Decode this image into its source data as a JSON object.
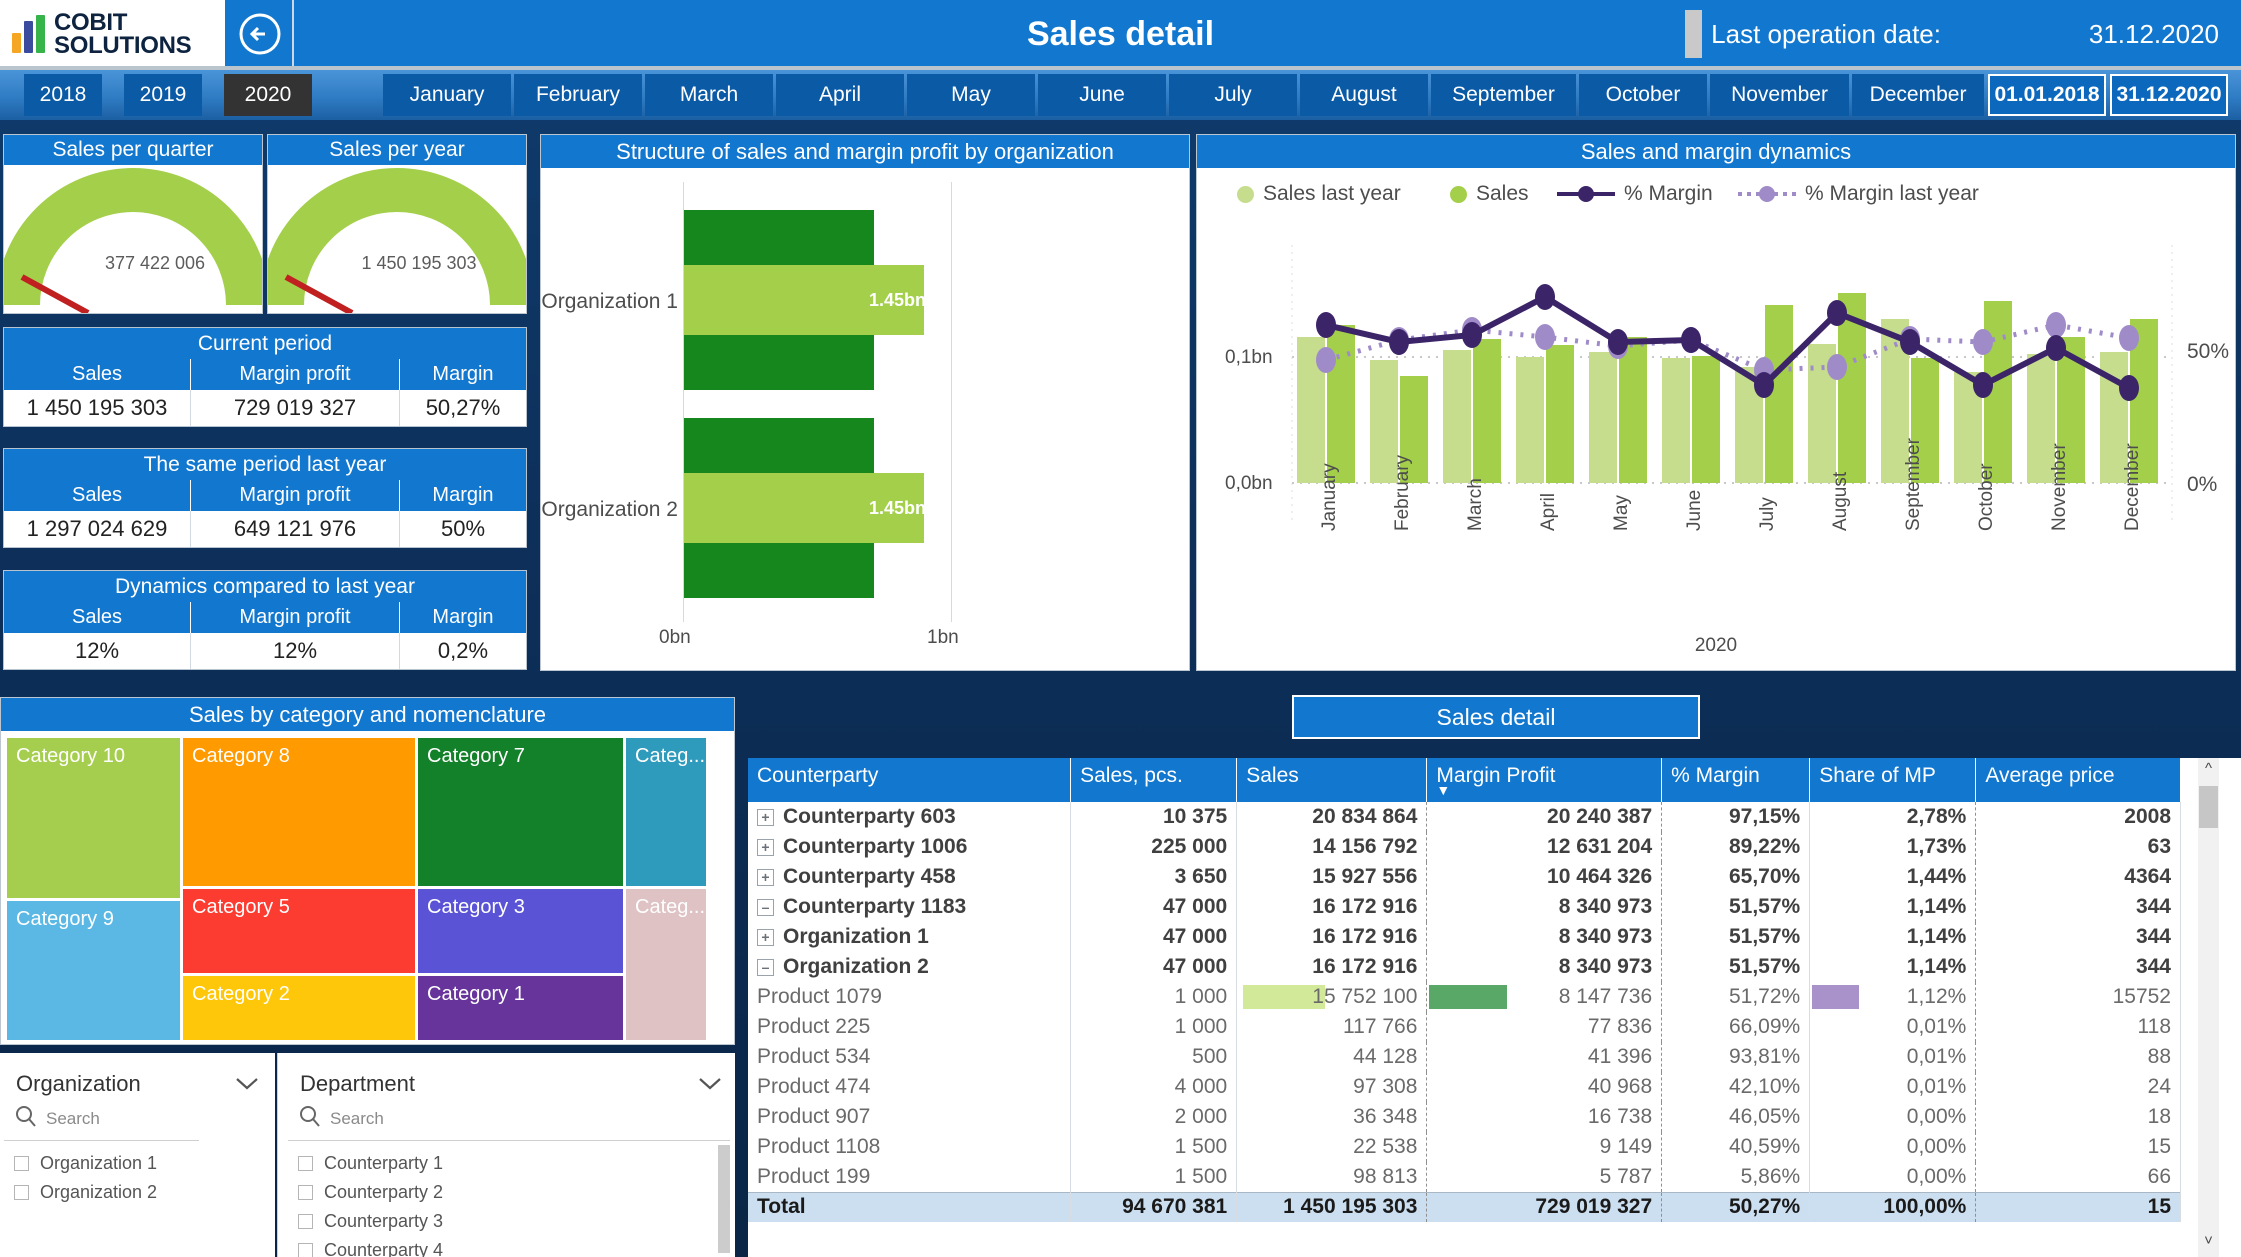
{
  "header": {
    "logo_line1": "COBIT",
    "logo_line2": "SOLUTIONS",
    "back_icon": "back-arrow-icon",
    "title": "Sales detail",
    "last_operation_label": "Last operation date:",
    "last_operation_date": "31.12.2020"
  },
  "filters": {
    "years": [
      {
        "label": "2018",
        "selected": false
      },
      {
        "label": "2019",
        "selected": false
      },
      {
        "label": "2020",
        "selected": true
      }
    ],
    "months": [
      "January",
      "February",
      "March",
      "April",
      "May",
      "June",
      "July",
      "August",
      "September",
      "October",
      "November",
      "December"
    ],
    "date_from": "01.01.2018",
    "date_to": "31.12.2020"
  },
  "gauges": [
    {
      "title": "Sales per quarter",
      "value": "377 422 006"
    },
    {
      "title": "Sales per year",
      "value": "1 450 195 303"
    }
  ],
  "kpi_tables": [
    {
      "title": "Current period",
      "columns": [
        "Sales",
        "Margin profit",
        "Margin"
      ],
      "values": [
        "1 450 195 303",
        "729 019 327",
        "50,27%"
      ]
    },
    {
      "title": "The same period last year",
      "columns": [
        "Sales",
        "Margin profit",
        "Margin"
      ],
      "values": [
        "1 297 024 629",
        "649 121 976",
        "50%"
      ]
    },
    {
      "title": "Dynamics compared to last year",
      "columns": [
        "Sales",
        "Margin profit",
        "Margin"
      ],
      "values": [
        "12%",
        "12%",
        "0,2%"
      ]
    }
  ],
  "org_chart": {
    "title": "Structure of sales and margin profit by organization",
    "chart_data": {
      "type": "bar",
      "title": "Structure of sales and margin profit by organization",
      "orientation": "horizontal",
      "categories": [
        "Organization 1",
        "Organization 2"
      ],
      "xlabel": "",
      "ylabel": "",
      "xlim": [
        0,
        1.45
      ],
      "xticks": [
        "0bn",
        "1bn"
      ],
      "grid": true,
      "series": [
        {
          "name": "Margin profit (top)",
          "color": "#16871d",
          "values": [
            0.73,
            0.73
          ],
          "labels": [
            "",
            ""
          ]
        },
        {
          "name": "Sales",
          "color": "#a4cf4b",
          "values": [
            1.45,
            1.45
          ],
          "labels": [
            "1.45bn",
            "1.45bn"
          ]
        },
        {
          "name": "Margin profit (bottom)",
          "color": "#16871d",
          "values": [
            0.73,
            0.73
          ],
          "labels": [
            "",
            ""
          ]
        }
      ]
    }
  },
  "dynamics_chart": {
    "title": "Sales and margin dynamics",
    "chart_data": {
      "type": "bar",
      "title": "Sales and margin dynamics",
      "categories": [
        "January",
        "February",
        "March",
        "April",
        "May",
        "June",
        "July",
        "August",
        "September",
        "October",
        "November",
        "December"
      ],
      "xlabel": "2020",
      "ylabel": "",
      "ylim": [
        0,
        0.14
      ],
      "yticks": [
        "0,0bn",
        "0,1bn"
      ],
      "y2lim": [
        0,
        70
      ],
      "y2ticks": [
        "0%",
        "50%"
      ],
      "grid": true,
      "legend": [
        {
          "label": "Sales last year",
          "color": "#c5dd8d",
          "marker": "dot"
        },
        {
          "label": "Sales",
          "color": "#a4cf4b",
          "marker": "dot"
        },
        {
          "label": "% Margin",
          "color": "#3b2468",
          "marker": "line-dot"
        },
        {
          "label": "% Margin last year",
          "color": "#a08bc9",
          "marker": "dotted-dot"
        }
      ],
      "series": [
        {
          "name": "Sales last year",
          "type": "bar",
          "color": "#c5dd8d",
          "values": [
            0.112,
            0.1,
            0.105,
            0.101,
            0.104,
            0.1,
            0.097,
            0.108,
            0.113,
            0.095,
            0.101,
            0.105
          ]
        },
        {
          "name": "Sales",
          "type": "bar",
          "color": "#a4cf4b",
          "values": [
            0.118,
            0.094,
            0.11,
            0.108,
            0.113,
            0.1,
            0.123,
            0.127,
            0.1,
            0.124,
            0.107,
            0.117
          ]
        },
        {
          "name": "% Margin",
          "type": "line",
          "color": "#3b2468",
          "values": [
            52.5,
            50.0,
            51.5,
            58.0,
            51.0,
            51.0,
            44.5,
            55.5,
            50.0,
            44.5,
            49.5,
            44.0
          ]
        },
        {
          "name": "% Margin last year",
          "type": "line",
          "color": "#a08bc9",
          "values": [
            47.0,
            50.0,
            52.0,
            50.5,
            48.5,
            50.0,
            46.0,
            46.5,
            50.5,
            50.5,
            52.5,
            50.0
          ]
        }
      ]
    }
  },
  "treemap": {
    "title": "Sales by category and nomenclature",
    "chart_data": {
      "type": "treemap",
      "title": "Sales by category and nomenclature",
      "tiles": [
        {
          "label": "Category 10",
          "color": "#a6ce4e",
          "truncated": false
        },
        {
          "label": "Category 9",
          "color": "#5bb8e5",
          "truncated": false
        },
        {
          "label": "Category 8",
          "color": "#ff9a00",
          "truncated": false
        },
        {
          "label": "Category 5",
          "color": "#fc3b31",
          "truncated": false
        },
        {
          "label": "Category 2",
          "color": "#ffc709",
          "truncated": false
        },
        {
          "label": "Category 7",
          "color": "#13802a",
          "truncated": false
        },
        {
          "label": "Category 3",
          "color": "#5a53d6",
          "truncated": false
        },
        {
          "label": "Category 1",
          "color": "#66349a",
          "truncated": false
        },
        {
          "label": "Categ...",
          "color": "#2f9bbc",
          "truncated": true
        },
        {
          "label": "Categ...",
          "color": "#dec2c4",
          "truncated": true
        }
      ]
    }
  },
  "slicers": [
    {
      "title": "Organization",
      "chevron_icon": "chevron-down-icon",
      "search_icon": "search-icon",
      "search_placeholder": "Search",
      "items": [
        "Organization 1",
        "Organization 2"
      ],
      "has_scrollbar": false
    },
    {
      "title": "Department",
      "chevron_icon": "chevron-down-icon",
      "search_icon": "search-icon",
      "search_placeholder": "Search",
      "items": [
        "Counterparty 1",
        "Counterparty 2",
        "Counterparty 3",
        "Counterparty 4"
      ],
      "has_scrollbar": true
    }
  ],
  "detail": {
    "button_label": "Sales detail",
    "sort_icon": "sort-desc-icon",
    "sorted_column": "Margin Profit",
    "columns": [
      "Counterparty",
      "Sales, pcs.",
      "Sales",
      "Margin Profit",
      "% Margin",
      "Share of MP",
      "Average price"
    ],
    "rows": [
      {
        "level": 1,
        "expander": "plus",
        "name": "Counterparty 603",
        "cells": [
          "10 375",
          "20 834 864",
          "20 240 387",
          "97,15%",
          "2,78%",
          "2008"
        ]
      },
      {
        "level": 1,
        "expander": "plus",
        "name": "Counterparty 1006",
        "cells": [
          "225 000",
          "14 156 792",
          "12 631 204",
          "89,22%",
          "1,73%",
          "63"
        ]
      },
      {
        "level": 1,
        "expander": "plus",
        "name": "Counterparty 458",
        "cells": [
          "3 650",
          "15 927 556",
          "10 464 326",
          "65,70%",
          "1,44%",
          "4364"
        ]
      },
      {
        "level": 1,
        "expander": "minus",
        "name": "Counterparty 1183",
        "cells": [
          "47 000",
          "16 172 916",
          "8 340 973",
          "51,57%",
          "1,14%",
          "344"
        ]
      },
      {
        "level": 2,
        "expander": "plus",
        "name": "Organization 1",
        "cells": [
          "47 000",
          "16 172 916",
          "8 340 973",
          "51,57%",
          "1,14%",
          "344"
        ]
      },
      {
        "level": 2,
        "expander": "minus",
        "name": "Organization 2",
        "cells": [
          "47 000",
          "16 172 916",
          "8 340 973",
          "51,57%",
          "1,14%",
          "344"
        ]
      },
      {
        "level": 3,
        "expander": "none",
        "name": "Product 1079",
        "cells": [
          "1 000",
          "15 752 100",
          "8 147 736",
          "51,72%",
          "1,12%",
          "15752"
        ],
        "bars": {
          "sales": 0.9,
          "margin": 0.62,
          "share": 0.85
        }
      },
      {
        "level": 3,
        "expander": "none",
        "name": "Product 225",
        "cells": [
          "1 000",
          "117 766",
          "77 836",
          "66,09%",
          "0,01%",
          "118"
        ]
      },
      {
        "level": 3,
        "expander": "none",
        "name": "Product 534",
        "cells": [
          "500",
          "44 128",
          "41 396",
          "93,81%",
          "0,01%",
          "88"
        ]
      },
      {
        "level": 3,
        "expander": "none",
        "name": "Product 474",
        "cells": [
          "4 000",
          "97 308",
          "40 968",
          "42,10%",
          "0,01%",
          "24"
        ]
      },
      {
        "level": 3,
        "expander": "none",
        "name": "Product 907",
        "cells": [
          "2 000",
          "36 348",
          "16 738",
          "46,05%",
          "0,00%",
          "18"
        ]
      },
      {
        "level": 3,
        "expander": "none",
        "name": "Product 1108",
        "cells": [
          "1 500",
          "22 538",
          "9 149",
          "40,59%",
          "0,00%",
          "15"
        ]
      },
      {
        "level": 3,
        "expander": "none",
        "name": "Product 199",
        "cells": [
          "1 500",
          "98 813",
          "5 787",
          "5,86%",
          "0,00%",
          "66"
        ]
      }
    ],
    "total": {
      "name": "Total",
      "cells": [
        "94 670 381",
        "1 450 195 303",
        "729 019 327",
        "50,27%",
        "100,00%",
        "15"
      ]
    },
    "scrollbar": {
      "up_icon": "chevron-up-icon",
      "down_icon": "chevron-down-icon"
    }
  },
  "colors": {
    "brand_blue": "#1277ce",
    "tab_blue": "#0b5aa6",
    "tab_selected": "#333333",
    "sales_green": "#a4cf4b",
    "sales_ly_green": "#c5dd8d",
    "margin_dark_green": "#16871d",
    "margin_purple": "#3b2468",
    "margin_ly_purple": "#a08bc9"
  }
}
